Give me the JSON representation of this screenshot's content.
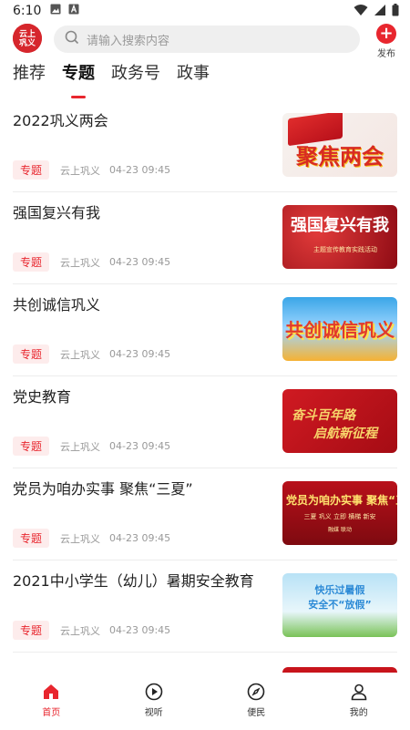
{
  "status_bar": {
    "time": "6:10"
  },
  "header": {
    "logo_text": "云上巩义",
    "search_placeholder": "请输入搜索内容",
    "publish_label": "发布"
  },
  "tabs": [
    {
      "label": "推荐",
      "active": false
    },
    {
      "label": "专题",
      "active": true
    },
    {
      "label": "政务号",
      "active": false
    },
    {
      "label": "政事",
      "active": false
    }
  ],
  "articles": [
    {
      "title": "2022巩义两会",
      "badge": "专题",
      "source": "云上巩义",
      "time": "04-23 09:45",
      "thumb_text": "聚焦两会"
    },
    {
      "title": "强国复兴有我",
      "badge": "专题",
      "source": "云上巩义",
      "time": "04-23 09:45",
      "thumb_text": "强国复兴有我",
      "thumb_sub": "主题宣传教育实践活动"
    },
    {
      "title": "共创诚信巩义",
      "badge": "专题",
      "source": "云上巩义",
      "time": "04-23 09:45",
      "thumb_text": "共创诚信巩义"
    },
    {
      "title": "党史教育",
      "badge": "专题",
      "source": "云上巩义",
      "time": "04-23 09:45",
      "thumb_line1": "奋斗百年路",
      "thumb_line2": "启航新征程"
    },
    {
      "title": "党员为咱办实事 聚焦“三夏”",
      "badge": "专题",
      "source": "云上巩义",
      "time": "04-23 09:45",
      "thumb_text": "党员为咱办实事 聚焦“三夏”",
      "thumb_sub": "三夏 巩义 立即 横梯 新安",
      "thumb_sub2": "融媒 联动"
    },
    {
      "title": "2021中小学生（幼儿）暑期安全教育",
      "badge": "专题",
      "source": "云上巩义",
      "time": "04-23 09:45",
      "thumb_line1": "快乐过暑假",
      "thumb_line2": "安全不“放假”"
    }
  ],
  "bottom_nav": [
    {
      "label": "首页",
      "icon": "home-icon",
      "active": true
    },
    {
      "label": "视听",
      "icon": "play-icon",
      "active": false
    },
    {
      "label": "便民",
      "icon": "compass-icon",
      "active": false
    },
    {
      "label": "我的",
      "icon": "user-icon",
      "active": false
    }
  ],
  "colors": {
    "accent": "#e8262e",
    "badge_bg": "#fdecec"
  }
}
